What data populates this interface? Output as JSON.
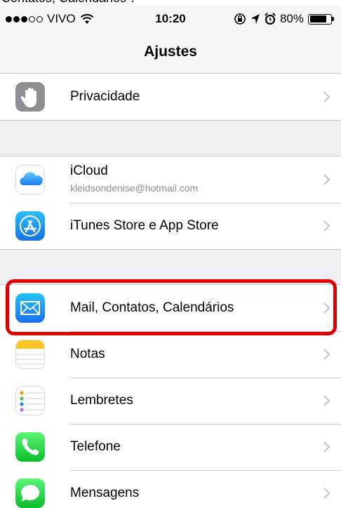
{
  "caption": "Contatos, Calendários\".",
  "status_bar": {
    "carrier": "VIVO",
    "signal_bars_filled": 3,
    "signal_bars_total": 5,
    "time": "10:20",
    "battery": "80%",
    "battery_level": 0.8
  },
  "nav": {
    "title": "Ajustes"
  },
  "groups": [
    {
      "items": [
        {
          "label": "Privacidade",
          "icon": "hand-icon",
          "color": "#8e8e93"
        }
      ]
    },
    {
      "items": [
        {
          "label": "iCloud",
          "sublabel": "kleidsondenise@hotmail.com",
          "icon": "cloud-icon",
          "color": "#ffffff"
        },
        {
          "label": "iTunes Store e App Store",
          "icon": "app-store-icon",
          "color": "#1a8cf0"
        }
      ]
    },
    {
      "items": [
        {
          "label": "Mail, Contatos, Calendários",
          "icon": "mail-icon",
          "color": "#1e8cf5",
          "highlighted": true
        },
        {
          "label": "Notas",
          "icon": "notes-icon",
          "color": "#ffffff"
        },
        {
          "label": "Lembretes",
          "icon": "reminders-icon",
          "color": "#ffffff"
        },
        {
          "label": "Telefone",
          "icon": "phone-icon",
          "color": "#34c759"
        },
        {
          "label": "Mensagens",
          "icon": "messages-icon",
          "color": "#34c759"
        }
      ]
    }
  ],
  "highlight_color": "#e00000"
}
